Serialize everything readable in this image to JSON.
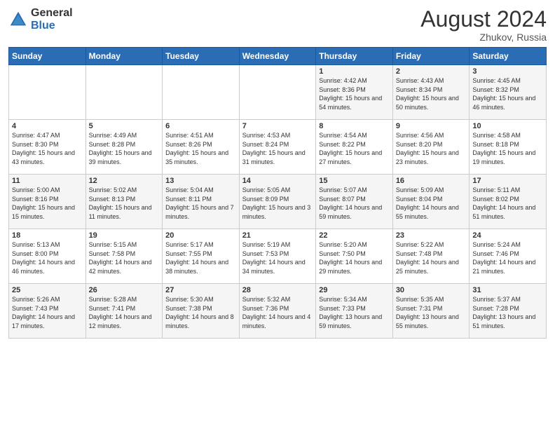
{
  "header": {
    "logo_general": "General",
    "logo_blue": "Blue",
    "month_year": "August 2024",
    "location": "Zhukov, Russia"
  },
  "weekdays": [
    "Sunday",
    "Monday",
    "Tuesday",
    "Wednesday",
    "Thursday",
    "Friday",
    "Saturday"
  ],
  "weeks": [
    [
      {
        "day": "",
        "sunrise": "",
        "sunset": "",
        "daylight": ""
      },
      {
        "day": "",
        "sunrise": "",
        "sunset": "",
        "daylight": ""
      },
      {
        "day": "",
        "sunrise": "",
        "sunset": "",
        "daylight": ""
      },
      {
        "day": "",
        "sunrise": "",
        "sunset": "",
        "daylight": ""
      },
      {
        "day": "1",
        "sunrise": "Sunrise: 4:42 AM",
        "sunset": "Sunset: 8:36 PM",
        "daylight": "Daylight: 15 hours and 54 minutes."
      },
      {
        "day": "2",
        "sunrise": "Sunrise: 4:43 AM",
        "sunset": "Sunset: 8:34 PM",
        "daylight": "Daylight: 15 hours and 50 minutes."
      },
      {
        "day": "3",
        "sunrise": "Sunrise: 4:45 AM",
        "sunset": "Sunset: 8:32 PM",
        "daylight": "Daylight: 15 hours and 46 minutes."
      }
    ],
    [
      {
        "day": "4",
        "sunrise": "Sunrise: 4:47 AM",
        "sunset": "Sunset: 8:30 PM",
        "daylight": "Daylight: 15 hours and 43 minutes."
      },
      {
        "day": "5",
        "sunrise": "Sunrise: 4:49 AM",
        "sunset": "Sunset: 8:28 PM",
        "daylight": "Daylight: 15 hours and 39 minutes."
      },
      {
        "day": "6",
        "sunrise": "Sunrise: 4:51 AM",
        "sunset": "Sunset: 8:26 PM",
        "daylight": "Daylight: 15 hours and 35 minutes."
      },
      {
        "day": "7",
        "sunrise": "Sunrise: 4:53 AM",
        "sunset": "Sunset: 8:24 PM",
        "daylight": "Daylight: 15 hours and 31 minutes."
      },
      {
        "day": "8",
        "sunrise": "Sunrise: 4:54 AM",
        "sunset": "Sunset: 8:22 PM",
        "daylight": "Daylight: 15 hours and 27 minutes."
      },
      {
        "day": "9",
        "sunrise": "Sunrise: 4:56 AM",
        "sunset": "Sunset: 8:20 PM",
        "daylight": "Daylight: 15 hours and 23 minutes."
      },
      {
        "day": "10",
        "sunrise": "Sunrise: 4:58 AM",
        "sunset": "Sunset: 8:18 PM",
        "daylight": "Daylight: 15 hours and 19 minutes."
      }
    ],
    [
      {
        "day": "11",
        "sunrise": "Sunrise: 5:00 AM",
        "sunset": "Sunset: 8:16 PM",
        "daylight": "Daylight: 15 hours and 15 minutes."
      },
      {
        "day": "12",
        "sunrise": "Sunrise: 5:02 AM",
        "sunset": "Sunset: 8:13 PM",
        "daylight": "Daylight: 15 hours and 11 minutes."
      },
      {
        "day": "13",
        "sunrise": "Sunrise: 5:04 AM",
        "sunset": "Sunset: 8:11 PM",
        "daylight": "Daylight: 15 hours and 7 minutes."
      },
      {
        "day": "14",
        "sunrise": "Sunrise: 5:05 AM",
        "sunset": "Sunset: 8:09 PM",
        "daylight": "Daylight: 15 hours and 3 minutes."
      },
      {
        "day": "15",
        "sunrise": "Sunrise: 5:07 AM",
        "sunset": "Sunset: 8:07 PM",
        "daylight": "Daylight: 14 hours and 59 minutes."
      },
      {
        "day": "16",
        "sunrise": "Sunrise: 5:09 AM",
        "sunset": "Sunset: 8:04 PM",
        "daylight": "Daylight: 14 hours and 55 minutes."
      },
      {
        "day": "17",
        "sunrise": "Sunrise: 5:11 AM",
        "sunset": "Sunset: 8:02 PM",
        "daylight": "Daylight: 14 hours and 51 minutes."
      }
    ],
    [
      {
        "day": "18",
        "sunrise": "Sunrise: 5:13 AM",
        "sunset": "Sunset: 8:00 PM",
        "daylight": "Daylight: 14 hours and 46 minutes."
      },
      {
        "day": "19",
        "sunrise": "Sunrise: 5:15 AM",
        "sunset": "Sunset: 7:58 PM",
        "daylight": "Daylight: 14 hours and 42 minutes."
      },
      {
        "day": "20",
        "sunrise": "Sunrise: 5:17 AM",
        "sunset": "Sunset: 7:55 PM",
        "daylight": "Daylight: 14 hours and 38 minutes."
      },
      {
        "day": "21",
        "sunrise": "Sunrise: 5:19 AM",
        "sunset": "Sunset: 7:53 PM",
        "daylight": "Daylight: 14 hours and 34 minutes."
      },
      {
        "day": "22",
        "sunrise": "Sunrise: 5:20 AM",
        "sunset": "Sunset: 7:50 PM",
        "daylight": "Daylight: 14 hours and 29 minutes."
      },
      {
        "day": "23",
        "sunrise": "Sunrise: 5:22 AM",
        "sunset": "Sunset: 7:48 PM",
        "daylight": "Daylight: 14 hours and 25 minutes."
      },
      {
        "day": "24",
        "sunrise": "Sunrise: 5:24 AM",
        "sunset": "Sunset: 7:46 PM",
        "daylight": "Daylight: 14 hours and 21 minutes."
      }
    ],
    [
      {
        "day": "25",
        "sunrise": "Sunrise: 5:26 AM",
        "sunset": "Sunset: 7:43 PM",
        "daylight": "Daylight: 14 hours and 17 minutes."
      },
      {
        "day": "26",
        "sunrise": "Sunrise: 5:28 AM",
        "sunset": "Sunset: 7:41 PM",
        "daylight": "Daylight: 14 hours and 12 minutes."
      },
      {
        "day": "27",
        "sunrise": "Sunrise: 5:30 AM",
        "sunset": "Sunset: 7:38 PM",
        "daylight": "Daylight: 14 hours and 8 minutes."
      },
      {
        "day": "28",
        "sunrise": "Sunrise: 5:32 AM",
        "sunset": "Sunset: 7:36 PM",
        "daylight": "Daylight: 14 hours and 4 minutes."
      },
      {
        "day": "29",
        "sunrise": "Sunrise: 5:34 AM",
        "sunset": "Sunset: 7:33 PM",
        "daylight": "Daylight: 13 hours and 59 minutes."
      },
      {
        "day": "30",
        "sunrise": "Sunrise: 5:35 AM",
        "sunset": "Sunset: 7:31 PM",
        "daylight": "Daylight: 13 hours and 55 minutes."
      },
      {
        "day": "31",
        "sunrise": "Sunrise: 5:37 AM",
        "sunset": "Sunset: 7:28 PM",
        "daylight": "Daylight: 13 hours and 51 minutes."
      }
    ]
  ]
}
